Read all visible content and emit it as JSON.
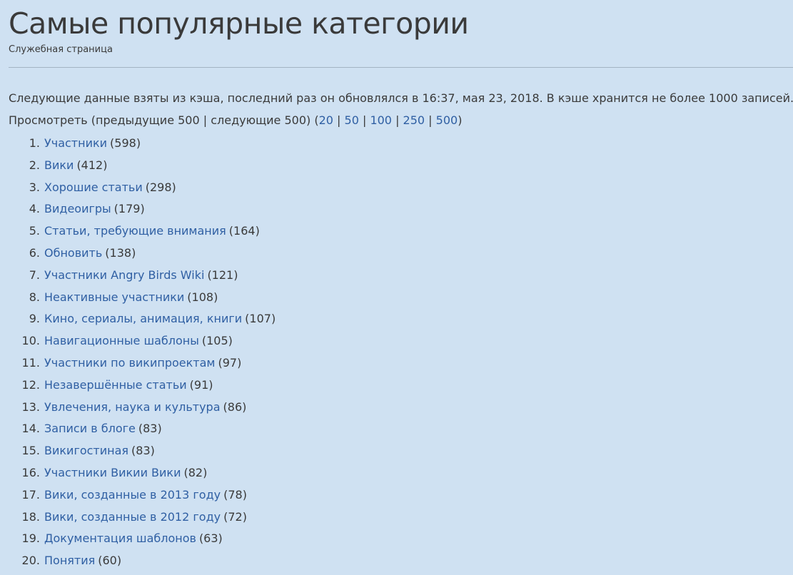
{
  "header": {
    "title": "Самые популярные категории",
    "subtitle": "Служебная страница"
  },
  "info": {
    "cache_notice": "Следующие данные взяты из кэша, последний раз он обновлялся в 16:37, мая 23, 2018. В кэше хранится не более 1000 записей."
  },
  "nav": {
    "prefix": "Просмотреть (предыдущие 500 | следующие 500) (",
    "limits": [
      "20",
      "50",
      "100",
      "250",
      "500"
    ],
    "separator": " | ",
    "suffix": ")"
  },
  "categories": [
    {
      "rank": "1.",
      "name": "Участники",
      "count": "(598)"
    },
    {
      "rank": "2.",
      "name": "Вики",
      "count": "(412)"
    },
    {
      "rank": "3.",
      "name": "Хорошие статьи",
      "count": "(298)"
    },
    {
      "rank": "4.",
      "name": "Видеоигры",
      "count": "(179)"
    },
    {
      "rank": "5.",
      "name": "Статьи, требующие внимания",
      "count": "(164)"
    },
    {
      "rank": "6.",
      "name": "Обновить",
      "count": "(138)"
    },
    {
      "rank": "7.",
      "name": "Участники Angry Birds Wiki",
      "count": "(121)"
    },
    {
      "rank": "8.",
      "name": "Неактивные участники",
      "count": "(108)"
    },
    {
      "rank": "9.",
      "name": "Кино, сериалы, анимация, книги",
      "count": "(107)"
    },
    {
      "rank": "10.",
      "name": "Навигационные шаблоны",
      "count": "(105)"
    },
    {
      "rank": "11.",
      "name": "Участники по википроектам",
      "count": "(97)"
    },
    {
      "rank": "12.",
      "name": "Незавершённые статьи",
      "count": "(91)"
    },
    {
      "rank": "13.",
      "name": "Увлечения, наука и культура",
      "count": "(86)"
    },
    {
      "rank": "14.",
      "name": "Записи в блоге",
      "count": "(83)"
    },
    {
      "rank": "15.",
      "name": "Викигостиная",
      "count": "(83)"
    },
    {
      "rank": "16.",
      "name": "Участники Викии Вики",
      "count": "(82)"
    },
    {
      "rank": "17.",
      "name": "Вики, созданные в 2013 году",
      "count": "(78)"
    },
    {
      "rank": "18.",
      "name": "Вики, созданные в 2012 году",
      "count": "(72)"
    },
    {
      "rank": "19.",
      "name": "Документация шаблонов",
      "count": "(63)"
    },
    {
      "rank": "20.",
      "name": "Понятия",
      "count": "(60)"
    }
  ],
  "colors": {
    "background": "#cfe1f2",
    "link": "#2f5fa3",
    "text": "#3a3a3a"
  }
}
